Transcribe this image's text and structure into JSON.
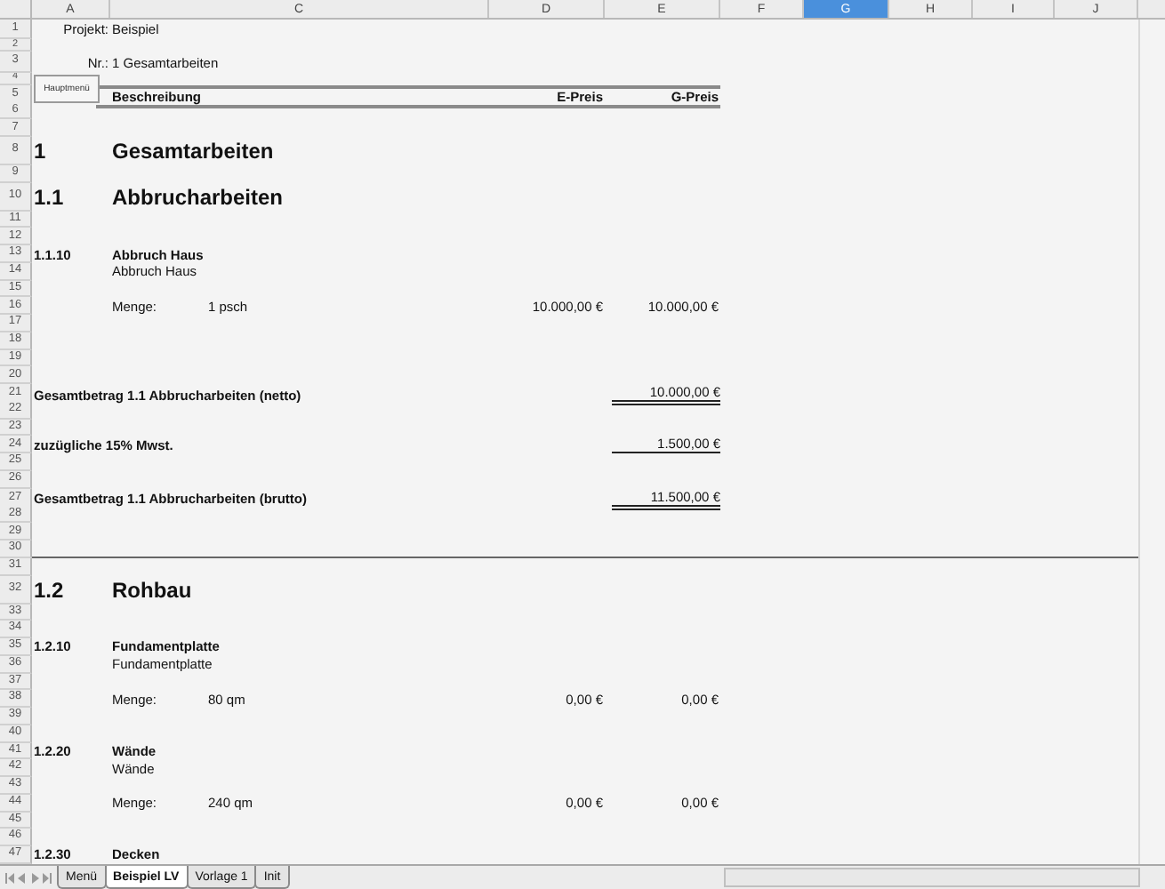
{
  "columns": [
    {
      "label": "A",
      "selected": false
    },
    {
      "label": "C",
      "selected": false
    },
    {
      "label": "D",
      "selected": false
    },
    {
      "label": "E",
      "selected": false
    },
    {
      "label": "F",
      "selected": false
    },
    {
      "label": "G",
      "selected": true
    },
    {
      "label": "H",
      "selected": false
    },
    {
      "label": "I",
      "selected": false
    },
    {
      "label": "J",
      "selected": false
    }
  ],
  "menu_button": {
    "label": "Hauptmenü"
  },
  "rows": [
    {
      "number": "1",
      "kind": "title",
      "a": "Projekt:",
      "c": "Beispiel"
    },
    {
      "number": "2",
      "kind": "spacer"
    },
    {
      "number": "3",
      "kind": "title",
      "a": "Nr.:",
      "c": "1 Gesamtarbeiten"
    },
    {
      "number": "4",
      "kind": "spacer"
    },
    {
      "number": "5",
      "kind": "header",
      "c": "Beschreibung",
      "d": "E-Preis",
      "e": "G-Preis"
    },
    {
      "number": "6",
      "kind": "blank"
    },
    {
      "number": "7",
      "kind": "blank"
    },
    {
      "number": "8",
      "kind": "heading",
      "a": "1",
      "c": "Gesamtarbeiten"
    },
    {
      "number": "9",
      "kind": "blank"
    },
    {
      "number": "10",
      "kind": "heading",
      "a": "1.1",
      "c": "Abbrucharbeiten"
    },
    {
      "number": "11",
      "kind": "blank"
    },
    {
      "number": "12",
      "kind": "blank"
    },
    {
      "number": "13",
      "kind": "item",
      "a": "1.1.10",
      "c": "Abbruch Haus"
    },
    {
      "number": "14",
      "kind": "text",
      "c": "Abbruch Haus"
    },
    {
      "number": "15",
      "kind": "blank"
    },
    {
      "number": "16",
      "kind": "quantity",
      "c": "Menge:",
      "amount": "1 psch",
      "d": "10.000,00 €",
      "e": "10.000,00 €"
    },
    {
      "number": "17",
      "kind": "blank"
    },
    {
      "number": "18",
      "kind": "blank"
    },
    {
      "number": "19",
      "kind": "blank"
    },
    {
      "number": "20",
      "kind": "blank"
    },
    {
      "number": "21",
      "kind": "total",
      "a": "Gesamtbetrag 1.1 Abbrucharbeiten (netto)",
      "e": "10.000,00 €",
      "double_underline": true
    },
    {
      "number": "22",
      "kind": "blank"
    },
    {
      "number": "23",
      "kind": "blank"
    },
    {
      "number": "24",
      "kind": "total",
      "a": "zuzügliche 15% Mwst.",
      "e": "1.500,00 €",
      "double_underline": false
    },
    {
      "number": "25",
      "kind": "blank"
    },
    {
      "number": "26",
      "kind": "blank"
    },
    {
      "number": "27",
      "kind": "total",
      "a": "Gesamtbetrag 1.1 Abbrucharbeiten (brutto)",
      "e": "11.500,00 €",
      "double_underline": true
    },
    {
      "number": "28",
      "kind": "blank"
    },
    {
      "number": "29",
      "kind": "blank"
    },
    {
      "number": "30",
      "kind": "break"
    },
    {
      "number": "31",
      "kind": "blank"
    },
    {
      "number": "32",
      "kind": "heading",
      "a": "1.2",
      "c": "Rohbau"
    },
    {
      "number": "33",
      "kind": "blank"
    },
    {
      "number": "34",
      "kind": "blank"
    },
    {
      "number": "35",
      "kind": "item",
      "a": "1.2.10",
      "c": "Fundamentplatte"
    },
    {
      "number": "36",
      "kind": "text",
      "c": "Fundamentplatte"
    },
    {
      "number": "37",
      "kind": "blank"
    },
    {
      "number": "38",
      "kind": "quantity",
      "c": "Menge:",
      "amount": "80 qm",
      "d": "0,00 €",
      "e": "0,00 €"
    },
    {
      "number": "39",
      "kind": "blank"
    },
    {
      "number": "40",
      "kind": "blank"
    },
    {
      "number": "41",
      "kind": "item",
      "a": "1.2.20",
      "c": "Wände"
    },
    {
      "number": "42",
      "kind": "text",
      "c": "Wände"
    },
    {
      "number": "43",
      "kind": "blank"
    },
    {
      "number": "44",
      "kind": "quantity",
      "c": "Menge:",
      "amount": "240 qm",
      "d": "0,00 €",
      "e": "0,00 €"
    },
    {
      "number": "45",
      "kind": "blank"
    },
    {
      "number": "46",
      "kind": "blank"
    },
    {
      "number": "47",
      "kind": "item",
      "a": "1.2.30",
      "c": "Decken"
    }
  ],
  "sheet_tabs": [
    {
      "label": "Menü",
      "selected": false
    },
    {
      "label": "Beispiel LV",
      "selected": true
    },
    {
      "label": "Vorlage 1",
      "selected": false
    },
    {
      "label": "Init",
      "selected": false
    }
  ]
}
